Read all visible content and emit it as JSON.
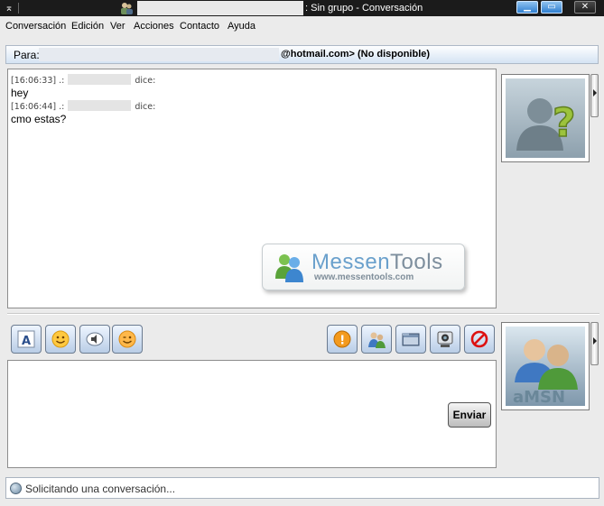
{
  "window": {
    "title": ": Sin grupo - Conversación",
    "controls": {
      "minimize": "▁",
      "maximize": "▭",
      "close": "✕"
    }
  },
  "menu": [
    "Conversación",
    "Edición",
    "Ver",
    "Acciones",
    "Contacto",
    "Ayuda"
  ],
  "to_bar": {
    "label": "Para:",
    "value": "@hotmail.com>  (No disponible)"
  },
  "conversation": {
    "messages": [
      {
        "time": "[16:06:33] .:",
        "says": "dice:",
        "text": "hey"
      },
      {
        "time": "[16:06:44] .:",
        "says": "dice:",
        "text": "cmo estas?"
      }
    ],
    "watermark": {
      "brand_light": "Messen",
      "brand_dark": "Tools",
      "url": "www.messentools.com"
    }
  },
  "avatars": {
    "contact_icon": "unknown-user-question-icon",
    "self_icon": "amsn-logo",
    "self_label": "aMSN"
  },
  "toolbar": {
    "left": [
      {
        "name": "font",
        "icon": "font-letter-icon",
        "glyph": "A"
      },
      {
        "name": "smileys",
        "icon": "smiley-icon"
      },
      {
        "name": "voice",
        "icon": "speaker-icon"
      },
      {
        "name": "wink",
        "icon": "wink-icon"
      }
    ],
    "right": [
      {
        "name": "nudge",
        "icon": "alert-icon",
        "glyph": "!"
      },
      {
        "name": "invite",
        "icon": "users-icon"
      },
      {
        "name": "send-file",
        "icon": "folder-icon"
      },
      {
        "name": "webcam",
        "icon": "webcam-icon"
      },
      {
        "name": "block",
        "icon": "block-icon"
      }
    ]
  },
  "input": {
    "value": "",
    "send_label": "Enviar"
  },
  "status": {
    "text": "Solicitando una conversación..."
  }
}
